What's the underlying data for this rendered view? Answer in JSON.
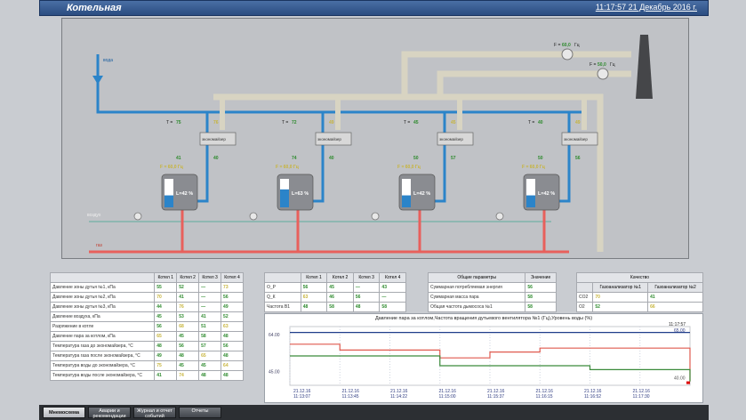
{
  "header": {
    "title": "Котельная",
    "datetime": "11:17:57 21 Декабрь 2016 г."
  },
  "mnemo": {
    "inflow_label": "вода",
    "gas_label": "газ",
    "air_label": "воздух",
    "econ_label": "экономайзер",
    "fans": [
      {
        "label": "F = ",
        "value": "60,0",
        "unit": "Гц"
      },
      {
        "label": "F = ",
        "value": "50,0",
        "unit": "Гц"
      }
    ],
    "units": [
      {
        "t_in": "75",
        "t_out": "76",
        "t_lo": "41",
        "t_eco": "40",
        "f": "60,0",
        "lvl": "42",
        "p_gas": "45,0",
        "p_air": "73,0",
        "f_air": "50,0",
        "p_vap": "85,0"
      },
      {
        "t_in": "72",
        "t_out": "49",
        "t_lo": "74",
        "t_eco": "40",
        "f": "60,0",
        "lvl": "63",
        "p_gas": "",
        "p_air": "",
        "f_air": "60,0",
        "p_vap": ""
      },
      {
        "t_in": "45",
        "t_out": "45",
        "t_lo": "50",
        "t_eco": "57",
        "f": "60,0",
        "lvl": "42",
        "p_gas": "",
        "p_air": "52,0",
        "f_air": "",
        "p_vap": "85,0"
      },
      {
        "t_in": "40",
        "t_out": "49",
        "t_lo": "50",
        "t_eco": "56",
        "f": "60,0",
        "lvl": "42",
        "p_gas": "",
        "p_air": "",
        "f_air": "",
        "p_vap": ""
      }
    ]
  },
  "table1": {
    "headers": [
      "",
      "Котел 1",
      "Котел 2",
      "Котел 3",
      "Котел 4"
    ],
    "rows": [
      [
        "Давление зоны дутья №1, кПа",
        "55",
        "52",
        "—",
        "73"
      ],
      [
        "Давление зоны дутья №2, кПа",
        "70",
        "41",
        "—",
        "56"
      ],
      [
        "Давление зоны дутья №3, кПа",
        "44",
        "76",
        "—",
        "49"
      ],
      [
        "Давление воздуха, кПа",
        "45",
        "53",
        "41",
        "52"
      ],
      [
        "Разряжение в котле",
        "56",
        "68",
        "51",
        "63"
      ],
      [
        "Давление пара за котлом, кПа",
        "65",
        "45",
        "58",
        "48"
      ],
      [
        "Температура газа до экономайзера, °C",
        "48",
        "56",
        "57",
        "56"
      ],
      [
        "Температура газа после экономайзера, °C",
        "49",
        "48",
        "65",
        "48"
      ],
      [
        "Температура воды до экономайзера, °C",
        "75",
        "45",
        "45",
        "64"
      ],
      [
        "Температура воды после экономайзера, °C",
        "41",
        "74",
        "48",
        "48"
      ]
    ]
  },
  "table2": {
    "headers": [
      "",
      "Котел 1",
      "Котел 2",
      "Котел 3",
      "Котел 4"
    ],
    "rows": [
      [
        "О_Р",
        "56",
        "45",
        "—",
        "43"
      ],
      [
        "Q_К",
        "63",
        "46",
        "56",
        "—"
      ],
      [
        "Частота В1",
        "48",
        "58",
        "48",
        "58"
      ]
    ]
  },
  "table3": {
    "headers": [
      "Общие параметры",
      "Значение"
    ],
    "rows": [
      [
        "Суммарная потребляемая энергия",
        "56"
      ],
      [
        "Суммарная масса пара",
        "58"
      ],
      [
        "Общая частота дымососа №1",
        "58"
      ]
    ]
  },
  "table4": {
    "title": "Качество",
    "headers": [
      "",
      "Газоанализатор №1",
      "Газоанализатор №2"
    ],
    "rows": [
      [
        "CO2",
        "70",
        "41"
      ],
      [
        "O2",
        "52",
        "66"
      ]
    ]
  },
  "trend": {
    "title": "Давление пара за котлом,Частота вращения дутьевого вентилятора №1 (Гц),Уровень воды (%)",
    "y_ticks": [
      "64.00",
      "45.00"
    ],
    "right_ticks": [
      "11:17:57",
      "65.00",
      "40.00"
    ],
    "x_ticks": [
      [
        "21.12.16",
        "11:13:07"
      ],
      [
        "21.12.16",
        "11:13:45"
      ],
      [
        "21.12.16",
        "11:14:22"
      ],
      [
        "21.12.16",
        "11:15:00"
      ],
      [
        "21.12.16",
        "11:15:37"
      ],
      [
        "21.12.16",
        "11:16:15"
      ],
      [
        "21.12.16",
        "11:16:52"
      ],
      [
        "21.12.16",
        "11:17:30"
      ]
    ]
  },
  "chart_data": {
    "type": "line",
    "title": "Давление пара за котлом,Частота вращения дутьевого вентилятора №1 (Гц),Уровень воды (%)",
    "x": [
      "11:13:07",
      "11:13:45",
      "11:14:22",
      "11:15:00",
      "11:15:37",
      "11:16:15",
      "11:16:52",
      "11:17:30",
      "11:17:57"
    ],
    "series": [
      {
        "values": [
          65,
          65,
          65,
          65,
          65,
          65,
          65,
          65,
          65
        ],
        "color": "#1f3d8a"
      },
      {
        "values": [
          59,
          56,
          56,
          52,
          55,
          57,
          57,
          57,
          40
        ],
        "color": "#e05a4f"
      },
      {
        "values": [
          53,
          53,
          53,
          48,
          48,
          48,
          46,
          46,
          40
        ],
        "color": "#3b8a3b"
      }
    ],
    "ylim": [
      38,
      68
    ]
  },
  "tabs": [
    {
      "label": "Мнемосхема",
      "active": true
    },
    {
      "label": "Аварии и рекомендации",
      "active": false
    },
    {
      "label": "Журнал и отчет событий",
      "active": false
    },
    {
      "label": "Отчеты",
      "active": false
    }
  ],
  "colors": {
    "hot": "#e8605c",
    "cold": "#2b84c9",
    "pipe": "#d8d4c2",
    "value_green": "#2d8a2d",
    "value_yellow": "#c7b43b"
  }
}
